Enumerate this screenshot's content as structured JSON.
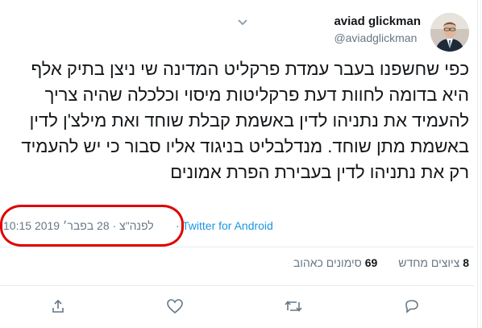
{
  "author": {
    "name": "aviad glickman",
    "handle": "@aviadglickman"
  },
  "tweet": {
    "text": "כפי שחשפנו בעבר עמדת פרקליט המדינה שי ניצן בתיק אלף היא בדומה לחוות דעת פרקליטות מיסוי וכלכלה שהיה צריך להעמיד את נתניהו לדין באשמת קבלת שוחד ואת מילצ'ן לדין באשמת מתן שוחד. מנדלבליט בניגוד אליו סבור כי יש להעמיד רק את נתניהו לדין בעבירת הפרת אמונים",
    "time_date": "10:15 לפנה\"צ · 28 בפבר׳ 2019",
    "client": "Twitter for Android"
  },
  "stats": {
    "retweets_count": "8",
    "retweets_label": "ציוצים מחדש",
    "likes_count": "69",
    "likes_label": "סימונים כאהוב"
  },
  "icons": {
    "share": "share-icon",
    "like": "heart-icon",
    "retweet": "retweet-icon",
    "reply": "reply-icon",
    "menu": "chevron-down-icon"
  },
  "colors": {
    "text": "#14171a",
    "muted": "#657786",
    "link": "#1b95e0",
    "highlight": "#e00000"
  }
}
